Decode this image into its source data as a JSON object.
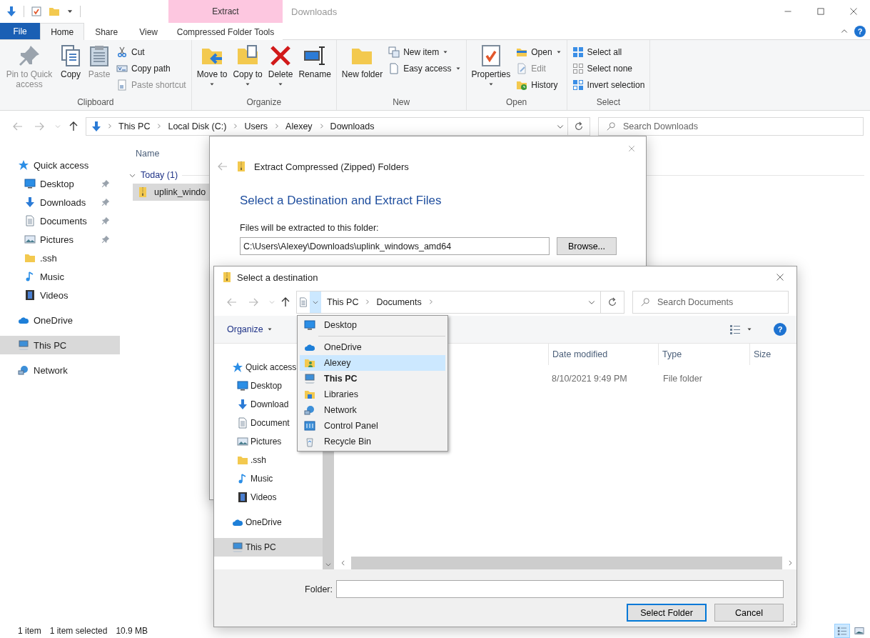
{
  "explorer": {
    "context_tab_group": "Extract",
    "title": "Downloads",
    "ribbon_tabs": [
      {
        "label": "File",
        "kind": "menu",
        "selected": false
      },
      {
        "label": "Home",
        "kind": "tab",
        "selected": true
      },
      {
        "label": "Share",
        "kind": "tab",
        "selected": false
      },
      {
        "label": "View",
        "kind": "tab",
        "selected": false
      },
      {
        "label": "Compressed Folder Tools",
        "kind": "tab",
        "selected": false
      }
    ],
    "help_button": "?",
    "ribbon_groups": [
      {
        "label": "Clipboard",
        "buttons": [
          {
            "kind": "large",
            "label": "Pin to Quick access",
            "dropdown": false,
            "disabled": true
          },
          {
            "kind": "large",
            "label": "Copy",
            "dropdown": false,
            "disabled": false
          },
          {
            "kind": "large",
            "label": "Paste",
            "dropdown": false,
            "disabled": true
          },
          {
            "kind": "small",
            "label": "Cut",
            "dropdown": false,
            "disabled": false
          },
          {
            "kind": "small",
            "label": "Copy path",
            "dropdown": false,
            "disabled": false
          },
          {
            "kind": "small",
            "label": "Paste shortcut",
            "dropdown": false,
            "disabled": true
          }
        ]
      },
      {
        "label": "Organize",
        "buttons": [
          {
            "kind": "large",
            "label": "Move to",
            "dropdown": true,
            "disabled": false
          },
          {
            "kind": "large",
            "label": "Copy to",
            "dropdown": true,
            "disabled": false
          },
          {
            "kind": "large",
            "label": "Delete",
            "dropdown": true,
            "disabled": false
          },
          {
            "kind": "large",
            "label": "Rename",
            "dropdown": false,
            "disabled": false
          }
        ]
      },
      {
        "label": "New",
        "buttons": [
          {
            "kind": "large",
            "label": "New folder",
            "dropdown": false,
            "disabled": false
          },
          {
            "kind": "small",
            "label": "New item",
            "dropdown": true,
            "disabled": false
          },
          {
            "kind": "small",
            "label": "Easy access",
            "dropdown": true,
            "disabled": false
          }
        ]
      },
      {
        "label": "Open",
        "buttons": [
          {
            "kind": "large",
            "label": "Properties",
            "dropdown": true,
            "disabled": false
          },
          {
            "kind": "small",
            "label": "Open",
            "dropdown": true,
            "disabled": false
          },
          {
            "kind": "small",
            "label": "Edit",
            "dropdown": false,
            "disabled": true
          },
          {
            "kind": "small",
            "label": "History",
            "dropdown": false,
            "disabled": false
          }
        ]
      },
      {
        "label": "Select",
        "buttons": [
          {
            "kind": "small",
            "label": "Select all",
            "dropdown": false,
            "disabled": false
          },
          {
            "kind": "small",
            "label": "Select none",
            "dropdown": false,
            "disabled": false
          },
          {
            "kind": "small",
            "label": "Invert selection",
            "dropdown": false,
            "disabled": false
          }
        ]
      }
    ],
    "address": {
      "crumbs": [
        "This PC",
        "Local Disk (C:)",
        "Users",
        "Alexey",
        "Downloads"
      ]
    },
    "search": {
      "placeholder": "Search Downloads"
    },
    "nav": [
      {
        "label": "Quick access",
        "selected": false,
        "children": [
          {
            "label": "Desktop",
            "pinned": true,
            "selected": false
          },
          {
            "label": "Downloads",
            "pinned": true,
            "selected": false
          },
          {
            "label": "Documents",
            "pinned": true,
            "selected": false
          },
          {
            "label": "Pictures",
            "pinned": true,
            "selected": false
          },
          {
            "label": ".ssh",
            "pinned": false,
            "selected": false
          },
          {
            "label": "Music",
            "pinned": false,
            "selected": false
          },
          {
            "label": "Videos",
            "pinned": false,
            "selected": false
          }
        ]
      },
      {
        "label": "OneDrive",
        "selected": false
      },
      {
        "label": "This PC",
        "selected": true
      },
      {
        "label": "Network",
        "selected": false
      }
    ],
    "file_list": {
      "columns": [
        "Name"
      ],
      "groups": [
        {
          "label": "Today (1)",
          "expanded": true,
          "files": [
            {
              "name": "uplink_windo",
              "selected": true
            }
          ]
        }
      ]
    },
    "status_bar": {
      "item_count": "1 item",
      "selection": "1 item selected",
      "size": "10.9 MB"
    },
    "view_buttons": [
      {
        "selected": true
      },
      {
        "selected": false
      }
    ]
  },
  "extract_dialog": {
    "title": "Extract Compressed (Zipped) Folders",
    "heading": "Select a Destination and Extract Files",
    "path_label": "Files will be extracted to this folder:",
    "path_value": "C:\\Users\\Alexey\\Downloads\\uplink_windows_amd64",
    "browse_button": "Browse..."
  },
  "select_dialog": {
    "title": "Select a destination",
    "crumbs": [
      "This PC",
      "Documents"
    ],
    "search": {
      "placeholder": "Search Documents"
    },
    "organize_button": "Organize",
    "help_button": "?",
    "nav": [
      {
        "label": "Quick access",
        "selected": false,
        "children": [
          {
            "label": "Desktop",
            "selected": false
          },
          {
            "label": "Download",
            "selected": false
          },
          {
            "label": "Document",
            "selected": false
          },
          {
            "label": "Pictures",
            "selected": false
          },
          {
            "label": ".ssh",
            "selected": false
          },
          {
            "label": "Music",
            "selected": false
          },
          {
            "label": "Videos",
            "selected": false
          }
        ]
      },
      {
        "label": "OneDrive",
        "selected": false
      },
      {
        "label": "This PC",
        "selected": true
      }
    ],
    "columns": [
      "Date modified",
      "Type",
      "Size"
    ],
    "rows": [
      {
        "date_modified": "8/10/2021 9:49 PM",
        "type": "File folder"
      }
    ],
    "folder_label": "Folder:",
    "buttons": [
      {
        "label": "Select Folder",
        "default": true
      },
      {
        "label": "Cancel",
        "default": false
      }
    ],
    "location_menu": [
      {
        "label": "Desktop",
        "selected": false,
        "current": false
      },
      {
        "label": "OneDrive",
        "selected": false,
        "current": false
      },
      {
        "label": "Alexey",
        "selected": true,
        "current": false
      },
      {
        "label": "This PC",
        "selected": false,
        "current": true
      },
      {
        "label": "Libraries",
        "selected": false,
        "current": false
      },
      {
        "label": "Network",
        "selected": false,
        "current": false
      },
      {
        "label": "Control Panel",
        "selected": false,
        "current": false
      },
      {
        "label": "Recycle Bin",
        "selected": false,
        "current": false
      }
    ]
  }
}
